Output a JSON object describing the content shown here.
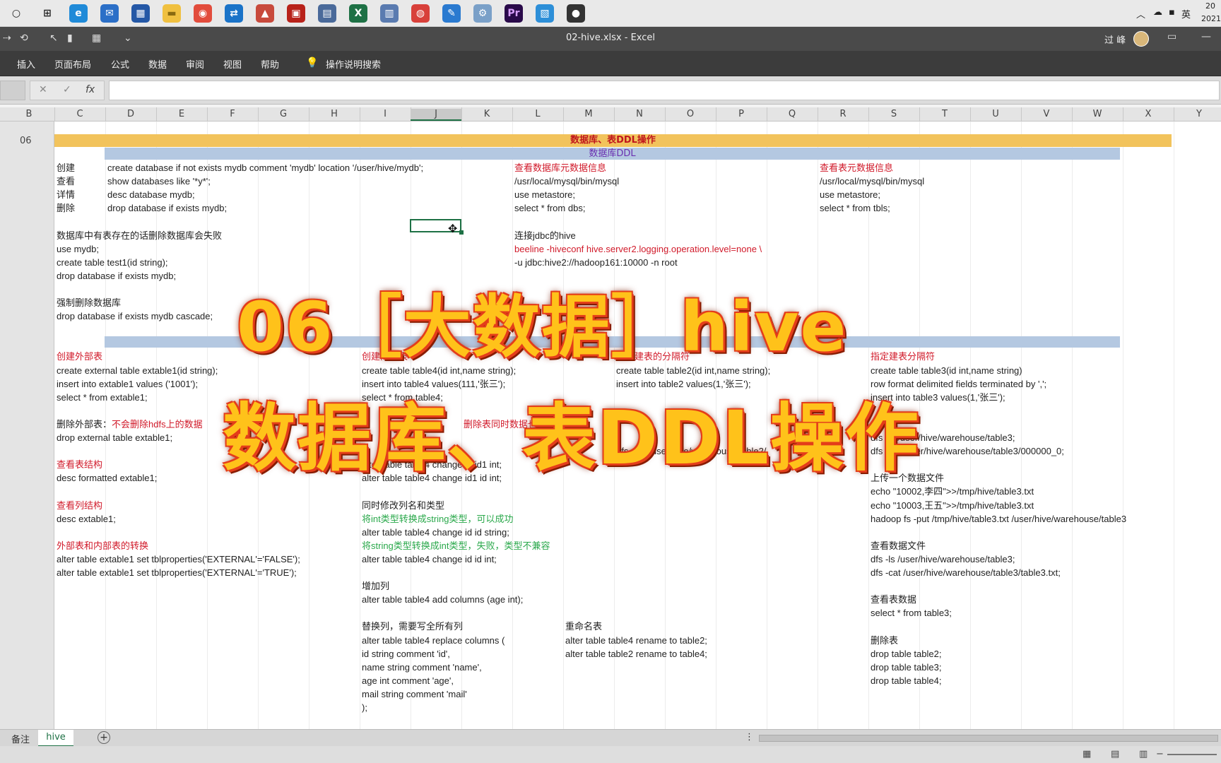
{
  "taskbar": {
    "icons": [
      {
        "name": "cortana-icon",
        "glyph": "○",
        "color": "#e9e9e9",
        "fg": "#222"
      },
      {
        "name": "task-view-icon",
        "glyph": "⊞",
        "color": "#e9e9e9",
        "fg": "#222"
      },
      {
        "name": "edge-icon",
        "glyph": "e",
        "color": "#1f8ad8",
        "fg": "#fff"
      },
      {
        "name": "mail-icon",
        "glyph": "✉",
        "color": "#2b6fc7",
        "fg": "#fff"
      },
      {
        "name": "store-icon",
        "glyph": "▦",
        "color": "#2458a6",
        "fg": "#fff"
      },
      {
        "name": "explorer-icon",
        "glyph": "▬",
        "color": "#f0c040",
        "fg": "#8a6a10"
      },
      {
        "name": "chrome-icon",
        "glyph": "◉",
        "color": "#e24c3c",
        "fg": "#fff"
      },
      {
        "name": "teamviewer-icon",
        "glyph": "⇄",
        "color": "#1a73c8",
        "fg": "#fff"
      },
      {
        "name": "app-red-icon",
        "glyph": "▲",
        "color": "#c84a3c",
        "fg": "#fff"
      },
      {
        "name": "app-stamp-icon",
        "glyph": "▣",
        "color": "#b8221a",
        "fg": "#fff"
      },
      {
        "name": "app-tools-icon",
        "glyph": "▤",
        "color": "#4a6a9a",
        "fg": "#fff"
      },
      {
        "name": "excel-icon",
        "glyph": "X",
        "color": "#1e7145",
        "fg": "#fff"
      },
      {
        "name": "app-window-icon",
        "glyph": "▥",
        "color": "#5a7bb0",
        "fg": "#fff"
      },
      {
        "name": "app-swirl-icon",
        "glyph": "◍",
        "color": "#d8403a",
        "fg": "#fff"
      },
      {
        "name": "app-note-icon",
        "glyph": "✎",
        "color": "#2a7ad0",
        "fg": "#fff"
      },
      {
        "name": "app-net-icon",
        "glyph": "⚙",
        "color": "#7aa0c8",
        "fg": "#fff"
      },
      {
        "name": "premiere-icon",
        "glyph": "Pr",
        "color": "#2a0a4a",
        "fg": "#d9a0ff"
      },
      {
        "name": "app-box-icon",
        "glyph": "▧",
        "color": "#2d8fd8",
        "fg": "#fff"
      },
      {
        "name": "obs-icon",
        "glyph": "●",
        "color": "#333333",
        "fg": "#fff"
      }
    ],
    "tray": {
      "ime": "英",
      "date_top": "20",
      "date_bottom": "2021"
    }
  },
  "titlebar": {
    "title": "02-hive.xlsx  -  Excel",
    "user": "过 峰"
  },
  "ribbon": {
    "tabs": [
      "插入",
      "页面布局",
      "公式",
      "数据",
      "审阅",
      "视图",
      "帮助",
      "操作说明搜索"
    ]
  },
  "formula_bar": {
    "cancel": "✕",
    "enter": "✓",
    "fx": "fx",
    "value": ""
  },
  "columns": [
    "B",
    "C",
    "D",
    "E",
    "F",
    "G",
    "H",
    "I",
    "J",
    "K",
    "L",
    "M",
    "N",
    "O",
    "P",
    "Q",
    "R",
    "S",
    "T",
    "U",
    "V",
    "W",
    "X",
    "Y"
  ],
  "row_label": "06",
  "sheet": {
    "band_title": "数据库、表DDL操作",
    "band_sub": "数据库DDL",
    "cells": [
      {
        "col": "C",
        "row": 0,
        "text": "创建"
      },
      {
        "col": "D",
        "row": 0,
        "text": "create database if not exists mydb comment 'mydb' location '/user/hive/mydb';"
      },
      {
        "col": "L",
        "row": 0,
        "text": "查看数据库元数据信息",
        "style": "red"
      },
      {
        "col": "R",
        "row": 0,
        "text": "查看表元数据信息",
        "style": "red"
      },
      {
        "col": "C",
        "row": 1,
        "text": "查看"
      },
      {
        "col": "D",
        "row": 1,
        "text": "show databases like '*y*';"
      },
      {
        "col": "L",
        "row": 1,
        "text": "/usr/local/mysql/bin/mysql"
      },
      {
        "col": "R",
        "row": 1,
        "text": "/usr/local/mysql/bin/mysql"
      },
      {
        "col": "C",
        "row": 2,
        "text": "详情"
      },
      {
        "col": "D",
        "row": 2,
        "text": "desc database mydb;"
      },
      {
        "col": "L",
        "row": 2,
        "text": "use metastore;"
      },
      {
        "col": "R",
        "row": 2,
        "text": "use metastore;"
      },
      {
        "col": "C",
        "row": 3,
        "text": "删除"
      },
      {
        "col": "D",
        "row": 3,
        "text": "drop database if exists mydb;"
      },
      {
        "col": "L",
        "row": 3,
        "text": "select * from dbs;"
      },
      {
        "col": "R",
        "row": 3,
        "text": "select * from tbls;"
      },
      {
        "col": "C",
        "row": 5,
        "text": "数据库中有表存在的话删除数据库会失败"
      },
      {
        "col": "L",
        "row": 5,
        "text": "连接jdbc的hive"
      },
      {
        "col": "C",
        "row": 6,
        "text": "use mydb;"
      },
      {
        "col": "L",
        "row": 6,
        "text": "beeline -hiveconf hive.server2.logging.operation.level=none \\",
        "style": "red"
      },
      {
        "col": "C",
        "row": 7,
        "text": "create table test1(id string);"
      },
      {
        "col": "L",
        "row": 7,
        "text": "-u jdbc:hive2://hadoop161:10000 -n root"
      },
      {
        "col": "C",
        "row": 8,
        "text": "drop database if exists mydb;"
      },
      {
        "col": "C",
        "row": 10,
        "text": "强制删除数据库"
      },
      {
        "col": "C",
        "row": 11,
        "text": "drop database if exists mydb cascade;"
      },
      {
        "col": "C",
        "row": 14,
        "text": "创建外部表",
        "style": "red"
      },
      {
        "col": "I",
        "row": 14,
        "text": "创建内部表",
        "style": "red"
      },
      {
        "col": "N",
        "row": 14,
        "text": "默认建表的分隔符",
        "style": "red"
      },
      {
        "col": "S",
        "row": 14,
        "text": "指定建表分隔符",
        "style": "red"
      },
      {
        "col": "C",
        "row": 15,
        "text": "create external table extable1(id string);"
      },
      {
        "col": "I",
        "row": 15,
        "text": "create table table4(id int,name string);"
      },
      {
        "col": "N",
        "row": 15,
        "text": "create table table2(id int,name string);"
      },
      {
        "col": "S",
        "row": 15,
        "text": "create table table3(id int,name string)"
      },
      {
        "col": "C",
        "row": 16,
        "text": "insert into extable1 values ('1001');"
      },
      {
        "col": "I",
        "row": 16,
        "text": "insert into table4 values(111,'张三');"
      },
      {
        "col": "N",
        "row": 16,
        "text": "insert into table2 values(1,'张三');"
      },
      {
        "col": "S",
        "row": 16,
        "text": "row format delimited fields terminated by ',';"
      },
      {
        "col": "C",
        "row": 17,
        "text": "select * from extable1;"
      },
      {
        "col": "I",
        "row": 17,
        "text": "select * from table4;"
      },
      {
        "col": "S",
        "row": 17,
        "text": "insert into table3 values(1,'张三');"
      },
      {
        "col": "C",
        "row": 19,
        "text": "删除外部表：",
        "extra": "不会删除hdfs上的数据",
        "style": "red-tail"
      },
      {
        "col": "K",
        "row": 19,
        "text": "删除表同时数据也删除",
        "style": "red"
      },
      {
        "col": "C",
        "row": 20,
        "text": "drop external table extable1;"
      },
      {
        "col": "S",
        "row": 20,
        "text": "dfs -ls /user/hive/warehouse/table3;"
      },
      {
        "col": "N",
        "row": 21,
        "text": "dfs -cat /user/hive/warehouse/table2/"
      },
      {
        "col": "S",
        "row": 21,
        "text": "dfs -cat /user/hive/warehouse/table3/000000_0;"
      },
      {
        "col": "C",
        "row": 22,
        "text": "查看表结构",
        "style": "red"
      },
      {
        "col": "I",
        "row": 22,
        "text": "alter table table4 change id id1 int;"
      },
      {
        "col": "C",
        "row": 23,
        "text": "desc formatted extable1;"
      },
      {
        "col": "I",
        "row": 23,
        "text": "alter table table4 change id1 id int;"
      },
      {
        "col": "S",
        "row": 23,
        "text": "上传一个数据文件"
      },
      {
        "col": "S",
        "row": 24,
        "text": "echo \"10002,李四\">>/tmp/hive/table3.txt"
      },
      {
        "col": "C",
        "row": 25,
        "text": "查看列结构",
        "style": "red"
      },
      {
        "col": "I",
        "row": 25,
        "text": "同时修改列名和类型"
      },
      {
        "col": "S",
        "row": 25,
        "text": "echo \"10003,王五\">>/tmp/hive/table3.txt"
      },
      {
        "col": "C",
        "row": 26,
        "text": "desc extable1;"
      },
      {
        "col": "I",
        "row": 26,
        "text": "将int类型转换成string类型，可以成功",
        "style": "green"
      },
      {
        "col": "S",
        "row": 26,
        "text": "hadoop fs -put /tmp/hive/table3.txt /user/hive/warehouse/table3"
      },
      {
        "col": "I",
        "row": 27,
        "text": "alter table table4 change id id string;"
      },
      {
        "col": "C",
        "row": 28,
        "text": "外部表和内部表的转换",
        "style": "red"
      },
      {
        "col": "I",
        "row": 28,
        "text": "将string类型转换成int类型，失败，类型不兼容",
        "style": "green"
      },
      {
        "col": "S",
        "row": 28,
        "text": "查看数据文件"
      },
      {
        "col": "C",
        "row": 29,
        "text": "alter table extable1 set tblproperties('EXTERNAL'='FALSE');"
      },
      {
        "col": "I",
        "row": 29,
        "text": "alter table table4 change id id int;"
      },
      {
        "col": "S",
        "row": 29,
        "text": "dfs -ls /user/hive/warehouse/table3;"
      },
      {
        "col": "C",
        "row": 30,
        "text": "alter table extable1 set tblproperties('EXTERNAL'='TRUE');"
      },
      {
        "col": "S",
        "row": 30,
        "text": "dfs -cat /user/hive/warehouse/table3/table3.txt;"
      },
      {
        "col": "I",
        "row": 31,
        "text": "增加列"
      },
      {
        "col": "I",
        "row": 32,
        "text": "alter table table4 add columns (age int);"
      },
      {
        "col": "S",
        "row": 32,
        "text": "查看表数据"
      },
      {
        "col": "S",
        "row": 33,
        "text": "select * from table3;"
      },
      {
        "col": "I",
        "row": 34,
        "text": "替换列，需要写全所有列"
      },
      {
        "col": "M",
        "row": 34,
        "text": "重命名表"
      },
      {
        "col": "I",
        "row": 35,
        "text": "alter table table4 replace columns ("
      },
      {
        "col": "M",
        "row": 35,
        "text": "alter table table4 rename to table2;"
      },
      {
        "col": "S",
        "row": 35,
        "text": "删除表"
      },
      {
        "col": "I",
        "row": 36,
        "text": "id string comment 'id',"
      },
      {
        "col": "M",
        "row": 36,
        "text": "alter table table2 rename to table4;"
      },
      {
        "col": "S",
        "row": 36,
        "text": "drop table table2;"
      },
      {
        "col": "I",
        "row": 37,
        "text": "name string comment 'name',"
      },
      {
        "col": "S",
        "row": 37,
        "text": "drop table table3;"
      },
      {
        "col": "I",
        "row": 38,
        "text": "age int comment 'age',"
      },
      {
        "col": "S",
        "row": 38,
        "text": "drop table table4;"
      },
      {
        "col": "I",
        "row": 39,
        "text": "mail string comment 'mail'"
      },
      {
        "col": "I",
        "row": 40,
        "text": ");"
      }
    ]
  },
  "overlay": {
    "line1": "06［大数据］hive",
    "line2": "数据库、表DDL操作"
  },
  "sheet_tabs": {
    "tab1": "备注",
    "tab2": "hive",
    "add": "+"
  },
  "status_icons": {
    "normal": "▦",
    "layout": "▤",
    "pagebreak": "▥",
    "minus": "−"
  }
}
